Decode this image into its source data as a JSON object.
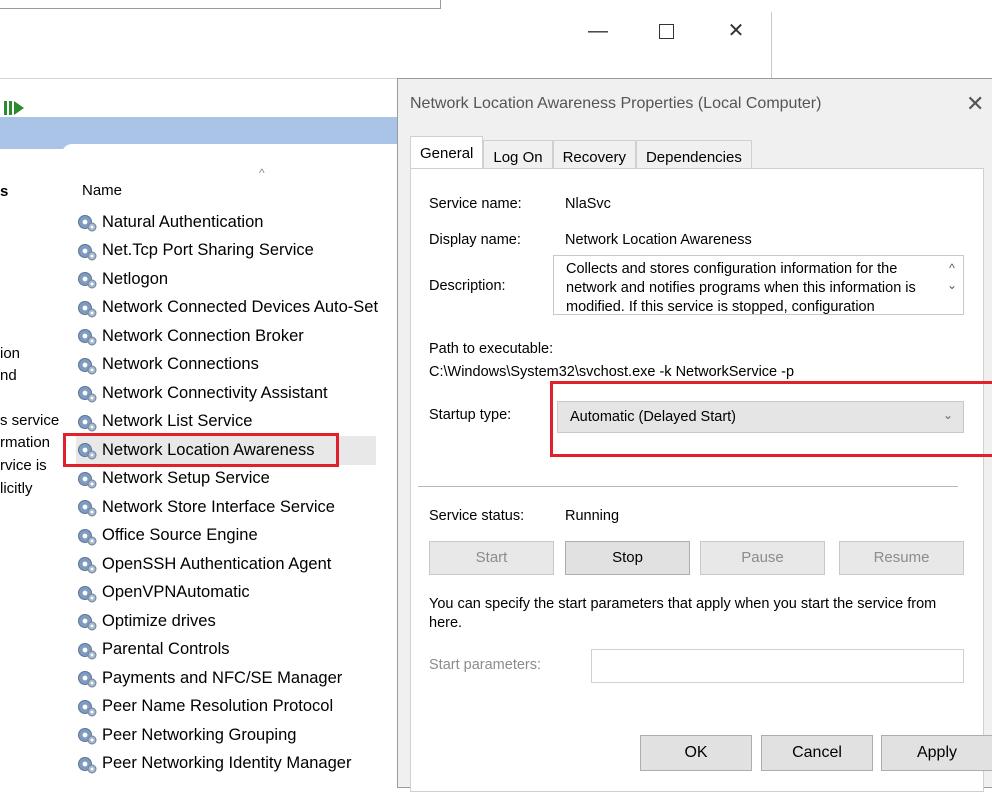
{
  "window": {
    "min_icon": "—",
    "close_icon": "✕"
  },
  "services_panel": {
    "column_header": "Name",
    "column_partial": "s",
    "sort_caret": "^",
    "description_partial": [
      "ion",
      "nd",
      "",
      "s service",
      "rmation",
      "rvice is",
      "licitly"
    ],
    "items": [
      "Natural Authentication",
      "Net.Tcp Port Sharing Service",
      "Netlogon",
      "Network Connected Devices Auto-Set",
      "Network Connection Broker",
      "Network Connections",
      "Network Connectivity Assistant",
      "Network List Service",
      "Network Location Awareness",
      "Network Setup Service",
      "Network Store Interface Service",
      "Office  Source Engine",
      "OpenSSH Authentication Agent",
      "OpenVPNAutomatic",
      "Optimize drives",
      "Parental Controls",
      "Payments and NFC/SE Manager",
      "Peer Name Resolution Protocol",
      "Peer Networking Grouping",
      "Peer Networking Identity Manager"
    ],
    "selected_index": 8
  },
  "dialog": {
    "title": "Network Location Awareness Properties (Local Computer)",
    "close_icon": "✕",
    "tabs": [
      "General",
      "Log On",
      "Recovery",
      "Dependencies"
    ],
    "active_tab": 0,
    "labels": {
      "service_name": "Service name:",
      "display_name": "Display name:",
      "description": "Description:",
      "path": "Path to executable:",
      "startup_type": "Startup type:",
      "service_status": "Service status:",
      "start_params_note": "You can specify the start parameters that apply when you start the service from here.",
      "start_params": "Start parameters:"
    },
    "values": {
      "service_name": "NlaSvc",
      "display_name": "Network Location Awareness",
      "description": "Collects and stores configuration information for the network and notifies programs when this information is modified. If this service is stopped, configuration",
      "path": "C:\\Windows\\System32\\svchost.exe -k NetworkService -p",
      "startup_type": "Automatic (Delayed Start)",
      "service_status": "Running",
      "start_params": ""
    },
    "buttons": {
      "start": "Start",
      "stop": "Stop",
      "pause": "Pause",
      "resume": "Resume",
      "ok": "OK",
      "cancel": "Cancel",
      "apply": "Apply"
    },
    "scroll_up": "^",
    "scroll_down": "⌄",
    "combo_arrow": "⌄"
  },
  "colors": {
    "highlight": "#e0202a",
    "banner": "#a9c4e6"
  }
}
